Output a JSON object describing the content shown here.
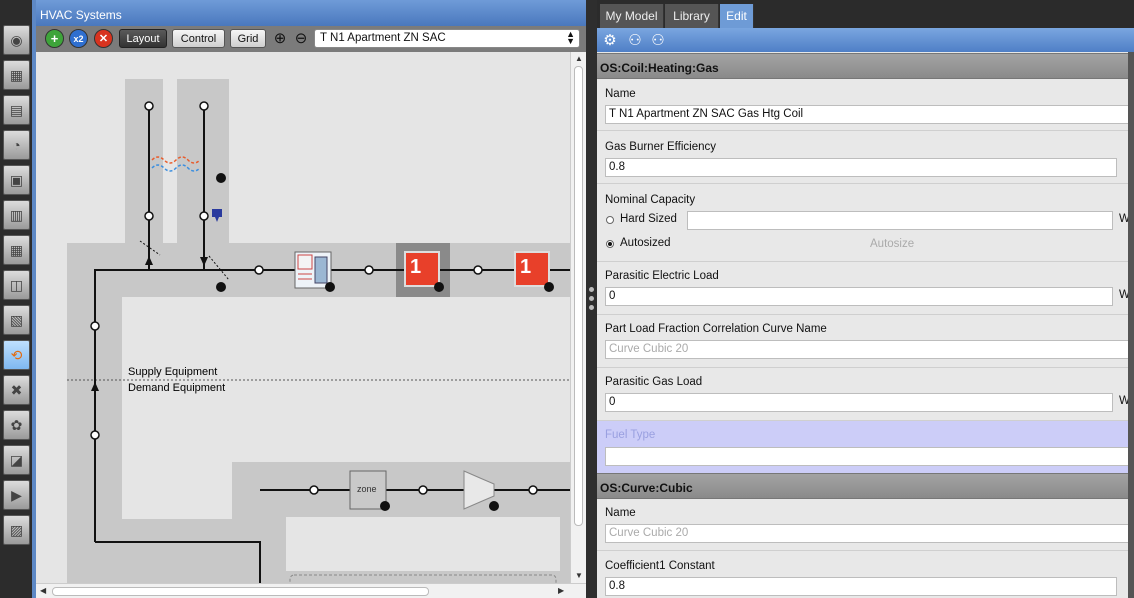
{
  "hvac": {
    "title": "HVAC Systems",
    "toolbar": {
      "add_label": "+",
      "x2_label": "x2",
      "delete_label": "✕",
      "layout_label": "Layout",
      "control_label": "Control",
      "grid_label": "Grid",
      "zoom_in_label": "⊕",
      "zoom_out_label": "⊖",
      "system_selected": "T N1 Apartment ZN SAC"
    },
    "canvas": {
      "supply_label": "Supply Equipment",
      "demand_label": "Demand Equipment",
      "zone_label": "zone",
      "coil_label": "1"
    }
  },
  "sidebar": {
    "icons": [
      "globe-icon",
      "calendar-icon",
      "building-construction-icon",
      "gauge-icon",
      "loads-icon",
      "space-types-icon",
      "facility-icon",
      "geometry-icon",
      "zones-icon",
      "hvac-icon",
      "measures-icon",
      "settings-icon",
      "reports-icon",
      "run-icon",
      "results-icon"
    ],
    "active_index": 9
  },
  "tabs": [
    {
      "label": "My Model"
    },
    {
      "label": "Library"
    },
    {
      "label": "Edit"
    }
  ],
  "inspector": {
    "section1_title": "OS:Coil:Heating:Gas",
    "name_label": "Name",
    "name_value": "T N1 Apartment ZN SAC Gas Htg Coil",
    "gas_eff_label": "Gas Burner Efficiency",
    "gas_eff_value": "0.8",
    "nominal_capacity_label": "Nominal Capacity",
    "hard_sized_label": "Hard Sized",
    "autosized_label": "Autosized",
    "autosize_label": "Autosize",
    "unit_w": "W",
    "parasitic_elec_label": "Parasitic Electric Load",
    "parasitic_elec_value": "0",
    "plf_curve_label": "Part Load Fraction Correlation Curve Name",
    "plf_curve_value": "Curve Cubic 20",
    "parasitic_gas_label": "Parasitic Gas Load",
    "parasitic_gas_value": "0",
    "fuel_type_label": "Fuel Type",
    "fuel_type_value": "",
    "section2_title": "OS:Curve:Cubic",
    "curve_name_label": "Name",
    "curve_name_value": "Curve Cubic 20",
    "coef1_label": "Coefficient1 Constant",
    "coef1_value": "0.8"
  }
}
